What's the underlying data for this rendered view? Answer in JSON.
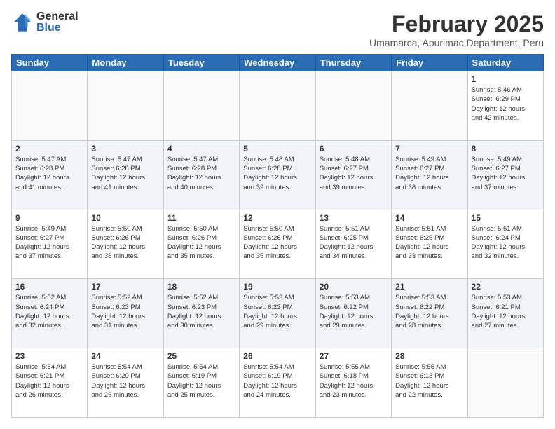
{
  "logo": {
    "general": "General",
    "blue": "Blue"
  },
  "title": {
    "month_year": "February 2025",
    "location": "Umamarca, Apurimac Department, Peru"
  },
  "weekdays": [
    "Sunday",
    "Monday",
    "Tuesday",
    "Wednesday",
    "Thursday",
    "Friday",
    "Saturday"
  ],
  "weeks": [
    [
      {
        "day": "",
        "info": ""
      },
      {
        "day": "",
        "info": ""
      },
      {
        "day": "",
        "info": ""
      },
      {
        "day": "",
        "info": ""
      },
      {
        "day": "",
        "info": ""
      },
      {
        "day": "",
        "info": ""
      },
      {
        "day": "1",
        "info": "Sunrise: 5:46 AM\nSunset: 6:29 PM\nDaylight: 12 hours\nand 42 minutes."
      }
    ],
    [
      {
        "day": "2",
        "info": "Sunrise: 5:47 AM\nSunset: 6:28 PM\nDaylight: 12 hours\nand 41 minutes."
      },
      {
        "day": "3",
        "info": "Sunrise: 5:47 AM\nSunset: 6:28 PM\nDaylight: 12 hours\nand 41 minutes."
      },
      {
        "day": "4",
        "info": "Sunrise: 5:47 AM\nSunset: 6:28 PM\nDaylight: 12 hours\nand 40 minutes."
      },
      {
        "day": "5",
        "info": "Sunrise: 5:48 AM\nSunset: 6:28 PM\nDaylight: 12 hours\nand 39 minutes."
      },
      {
        "day": "6",
        "info": "Sunrise: 5:48 AM\nSunset: 6:27 PM\nDaylight: 12 hours\nand 39 minutes."
      },
      {
        "day": "7",
        "info": "Sunrise: 5:49 AM\nSunset: 6:27 PM\nDaylight: 12 hours\nand 38 minutes."
      },
      {
        "day": "8",
        "info": "Sunrise: 5:49 AM\nSunset: 6:27 PM\nDaylight: 12 hours\nand 37 minutes."
      }
    ],
    [
      {
        "day": "9",
        "info": "Sunrise: 5:49 AM\nSunset: 6:27 PM\nDaylight: 12 hours\nand 37 minutes."
      },
      {
        "day": "10",
        "info": "Sunrise: 5:50 AM\nSunset: 6:26 PM\nDaylight: 12 hours\nand 36 minutes."
      },
      {
        "day": "11",
        "info": "Sunrise: 5:50 AM\nSunset: 6:26 PM\nDaylight: 12 hours\nand 35 minutes."
      },
      {
        "day": "12",
        "info": "Sunrise: 5:50 AM\nSunset: 6:26 PM\nDaylight: 12 hours\nand 35 minutes."
      },
      {
        "day": "13",
        "info": "Sunrise: 5:51 AM\nSunset: 6:25 PM\nDaylight: 12 hours\nand 34 minutes."
      },
      {
        "day": "14",
        "info": "Sunrise: 5:51 AM\nSunset: 6:25 PM\nDaylight: 12 hours\nand 33 minutes."
      },
      {
        "day": "15",
        "info": "Sunrise: 5:51 AM\nSunset: 6:24 PM\nDaylight: 12 hours\nand 32 minutes."
      }
    ],
    [
      {
        "day": "16",
        "info": "Sunrise: 5:52 AM\nSunset: 6:24 PM\nDaylight: 12 hours\nand 32 minutes."
      },
      {
        "day": "17",
        "info": "Sunrise: 5:52 AM\nSunset: 6:23 PM\nDaylight: 12 hours\nand 31 minutes."
      },
      {
        "day": "18",
        "info": "Sunrise: 5:52 AM\nSunset: 6:23 PM\nDaylight: 12 hours\nand 30 minutes."
      },
      {
        "day": "19",
        "info": "Sunrise: 5:53 AM\nSunset: 6:23 PM\nDaylight: 12 hours\nand 29 minutes."
      },
      {
        "day": "20",
        "info": "Sunrise: 5:53 AM\nSunset: 6:22 PM\nDaylight: 12 hours\nand 29 minutes."
      },
      {
        "day": "21",
        "info": "Sunrise: 5:53 AM\nSunset: 6:22 PM\nDaylight: 12 hours\nand 28 minutes."
      },
      {
        "day": "22",
        "info": "Sunrise: 5:53 AM\nSunset: 6:21 PM\nDaylight: 12 hours\nand 27 minutes."
      }
    ],
    [
      {
        "day": "23",
        "info": "Sunrise: 5:54 AM\nSunset: 6:21 PM\nDaylight: 12 hours\nand 26 minutes."
      },
      {
        "day": "24",
        "info": "Sunrise: 5:54 AM\nSunset: 6:20 PM\nDaylight: 12 hours\nand 26 minutes."
      },
      {
        "day": "25",
        "info": "Sunrise: 5:54 AM\nSunset: 6:19 PM\nDaylight: 12 hours\nand 25 minutes."
      },
      {
        "day": "26",
        "info": "Sunrise: 5:54 AM\nSunset: 6:19 PM\nDaylight: 12 hours\nand 24 minutes."
      },
      {
        "day": "27",
        "info": "Sunrise: 5:55 AM\nSunset: 6:18 PM\nDaylight: 12 hours\nand 23 minutes."
      },
      {
        "day": "28",
        "info": "Sunrise: 5:55 AM\nSunset: 6:18 PM\nDaylight: 12 hours\nand 22 minutes."
      },
      {
        "day": "",
        "info": ""
      }
    ]
  ]
}
